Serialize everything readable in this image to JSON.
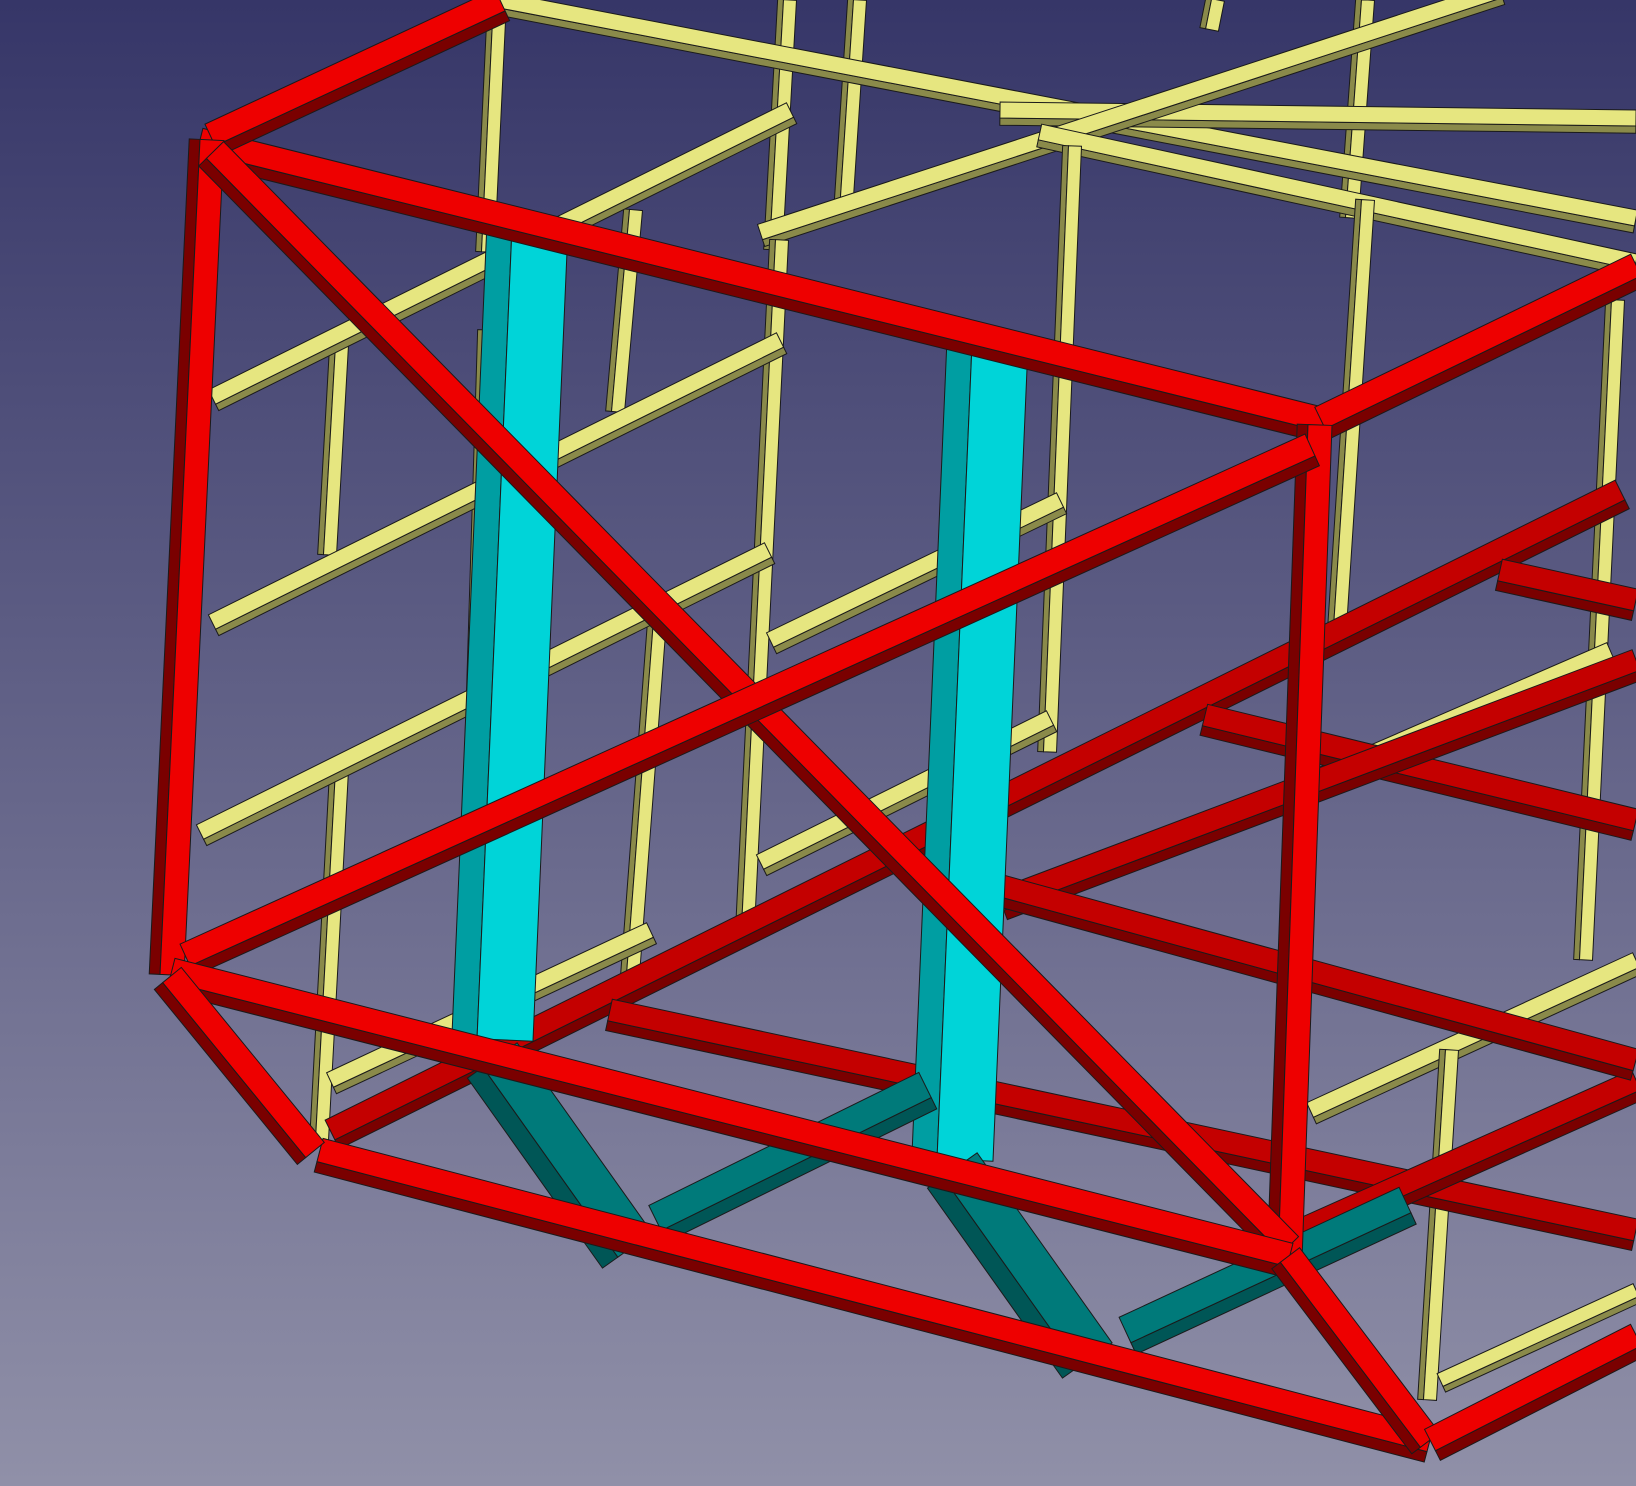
{
  "view": {
    "background_top": "#363668",
    "background_bottom": "#9090a8"
  },
  "colors": {
    "frame_red": "#ee0000",
    "frame_red_side": "#7a0000",
    "frame_red_mid": "#c40000",
    "stud_yellow": "#e6e680",
    "stud_yellow_side": "#8a8a4a",
    "post_cyan": "#00d4d8",
    "post_cyan_side": "#009ea2",
    "brace_teal": "#007a7a",
    "brace_teal_side": "#005656",
    "edge": "#1a1a1a"
  }
}
